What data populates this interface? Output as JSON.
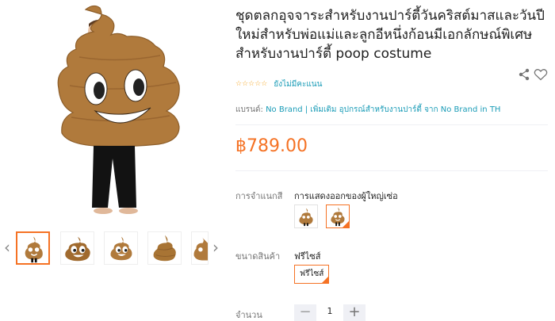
{
  "product": {
    "title": "ชุดตลกอุจจาระสำหรับงานปาร์ตี้วันคริสต์มาสและวันปีใหม่สำหรับพ่อแม่และลูกอีหนึ่งก้อนมีเอกลักษณ์พิเศษสำหรับงานปาร์ตี้ poop costume",
    "stars": "☆☆☆☆☆",
    "rating_text": "ยังไม่มีคะแนน",
    "brand_label": "แบรนด์:",
    "brand_name": "No Brand",
    "brand_more": "| เพิ่มเติม อุปกรณ์สำหรับงานปาร์ตี้ จาก No Brand in TH",
    "price": "฿789.00"
  },
  "variants": {
    "color_label": "การจำแนกสี",
    "color_value": "การแสดงออกของผู้ใหญ่เซ่อ",
    "size_label": "ขนาดสินค้า",
    "size_value": "ฟรีไซส์",
    "size_option": "ฟรีไซส์"
  },
  "quantity": {
    "label": "จำนวน",
    "value": "1",
    "minus": "−",
    "plus": "+"
  },
  "gallery": {
    "prev": "‹",
    "next": "›"
  },
  "colors": {
    "accent": "#f57224",
    "link": "#1a9cb7",
    "costume": "#b07a3c"
  }
}
